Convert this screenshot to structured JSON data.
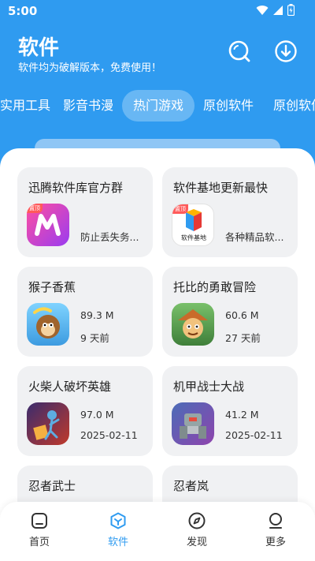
{
  "status": {
    "time": "5:00"
  },
  "header": {
    "title": "软件",
    "subtitle": "软件均为破解版本，免费使用！"
  },
  "tabs": [
    "实用工具",
    "影音书漫",
    "热门游戏",
    "原创软件",
    "原创软件"
  ],
  "active_tab": "热门游戏",
  "cards": [
    {
      "title": "迅腾软件库官方群",
      "meta": "防止丢失务...",
      "badge": "置顶"
    },
    {
      "title": "软件基地更新最快",
      "meta": "各种精品软...",
      "badge": "置顶",
      "icon_text": "软件基地"
    },
    {
      "title": "猴子香蕉",
      "size": "89.3 M",
      "date": "9 天前"
    },
    {
      "title": "托比的勇敢冒险",
      "size": "60.6 M",
      "date": "27 天前"
    },
    {
      "title": "火柴人破坏英雄",
      "size": "97.0 M",
      "date": "2025-02-11"
    },
    {
      "title": "机甲战士大战",
      "size": "41.2 M",
      "date": "2025-02-11"
    },
    {
      "title": "忍者武士"
    },
    {
      "title": "忍者岚"
    }
  ],
  "nav": [
    {
      "label": "首页"
    },
    {
      "label": "软件"
    },
    {
      "label": "发现"
    },
    {
      "label": "更多"
    }
  ],
  "active_nav": "软件",
  "colors": {
    "accent": "#2f9bf0",
    "card_bg": "#f0f1f3",
    "badge": "#ff5a5a"
  },
  "icons": [
    "wifi-icon",
    "signal-icon",
    "battery-icon",
    "search-icon",
    "download-icon",
    "home-icon",
    "apps-cube-icon",
    "compass-icon",
    "profile-icon"
  ]
}
